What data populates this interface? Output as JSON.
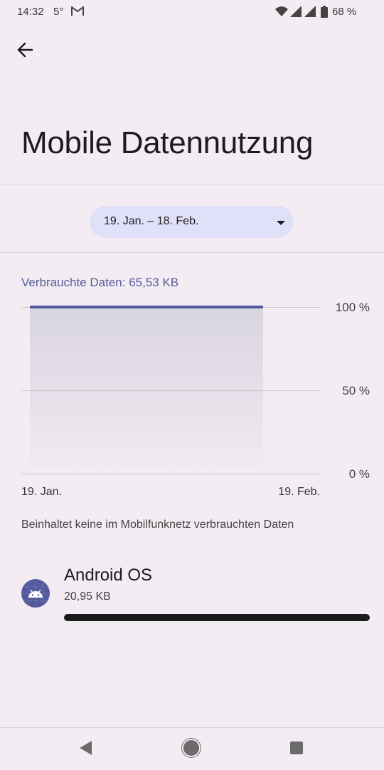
{
  "status_bar": {
    "time": "14:32",
    "temperature": "5°",
    "gmail_icon": "gmail-icon",
    "battery_percent": "68 %"
  },
  "header": {
    "title": "Mobile Datennutzung"
  },
  "date_picker": {
    "selected": "19. Jan. – 18. Feb."
  },
  "usage": {
    "label": "Verbrauchte Daten: 65,53 KB"
  },
  "chart_data": {
    "type": "area",
    "categories": [
      "19. Jan.",
      "19. Feb."
    ],
    "y_tick_labels": [
      "100 %",
      "50 %",
      "0 %"
    ],
    "ylim": [
      0,
      100
    ],
    "series": [
      {
        "values": [
          100,
          100
        ]
      }
    ],
    "grid": true
  },
  "note": "Beinhaltet keine im Mobilfunknetz verbrauchten Daten",
  "apps": [
    {
      "name": "Android OS",
      "size": "20,95 KB",
      "fraction": 1.0
    }
  ],
  "colors": {
    "accent": "#535b9e",
    "background": "#f3edf3",
    "picker": "#e1e0f9"
  }
}
